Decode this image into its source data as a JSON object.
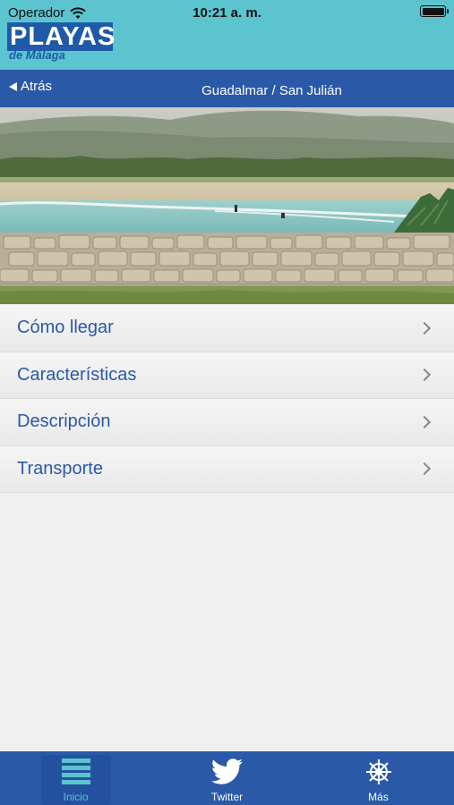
{
  "status_bar": {
    "carrier": "Operador",
    "time": "10:21 a. m."
  },
  "logo": {
    "main": "PLAYAS",
    "sub": "de Málaga"
  },
  "nav": {
    "back_label": "Atrás",
    "title": "Guadalmar / San Julián"
  },
  "menu": {
    "items": [
      {
        "label": "Cómo llegar"
      },
      {
        "label": "Características"
      },
      {
        "label": "Descripción"
      },
      {
        "label": "Transporte"
      }
    ]
  },
  "tabs": [
    {
      "label": "Inicio",
      "icon": "list-icon",
      "active": true
    },
    {
      "label": "Twitter",
      "icon": "twitter-bird-icon",
      "active": false
    },
    {
      "label": "Más",
      "icon": "ship-wheel-icon",
      "active": false
    }
  ],
  "colors": {
    "header_teal": "#5bc4cf",
    "brand_blue": "#2a59a8",
    "active_tab": "#5bc4cf"
  }
}
